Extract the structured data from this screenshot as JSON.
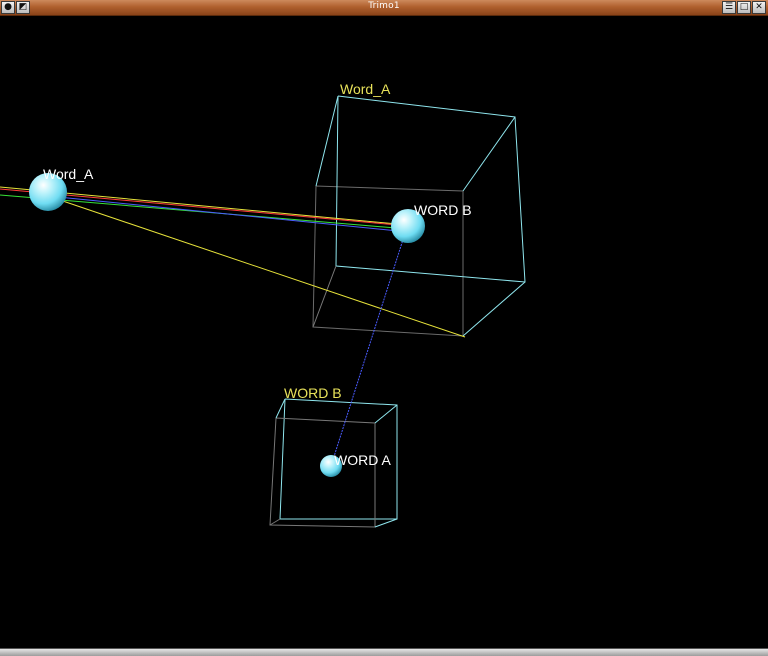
{
  "window": {
    "title": "Trimo1",
    "left_icons": [
      "window-menu-icon",
      "shade-icon"
    ],
    "right_icons": [
      "menu-icon",
      "maximize-icon",
      "close-icon"
    ]
  },
  "scene": {
    "colors": {
      "background": "#000000",
      "sphere": "#6fdcf2",
      "box_edge": "#8fe6ee",
      "box_edge_dim": "#777777",
      "box_label": "#e8e25a",
      "node_label": "#ffffff",
      "line_red": "#ff3b3b",
      "line_green": "#37e237",
      "line_blue": "#4a5cff",
      "line_yellow": "#e6e23a"
    },
    "box_labels": {
      "box_large": "Word_A",
      "box_small": "WORD B"
    },
    "node_labels": {
      "node_left": "Word_A",
      "node_center": "WORD B",
      "node_lower": "WORD A"
    }
  }
}
